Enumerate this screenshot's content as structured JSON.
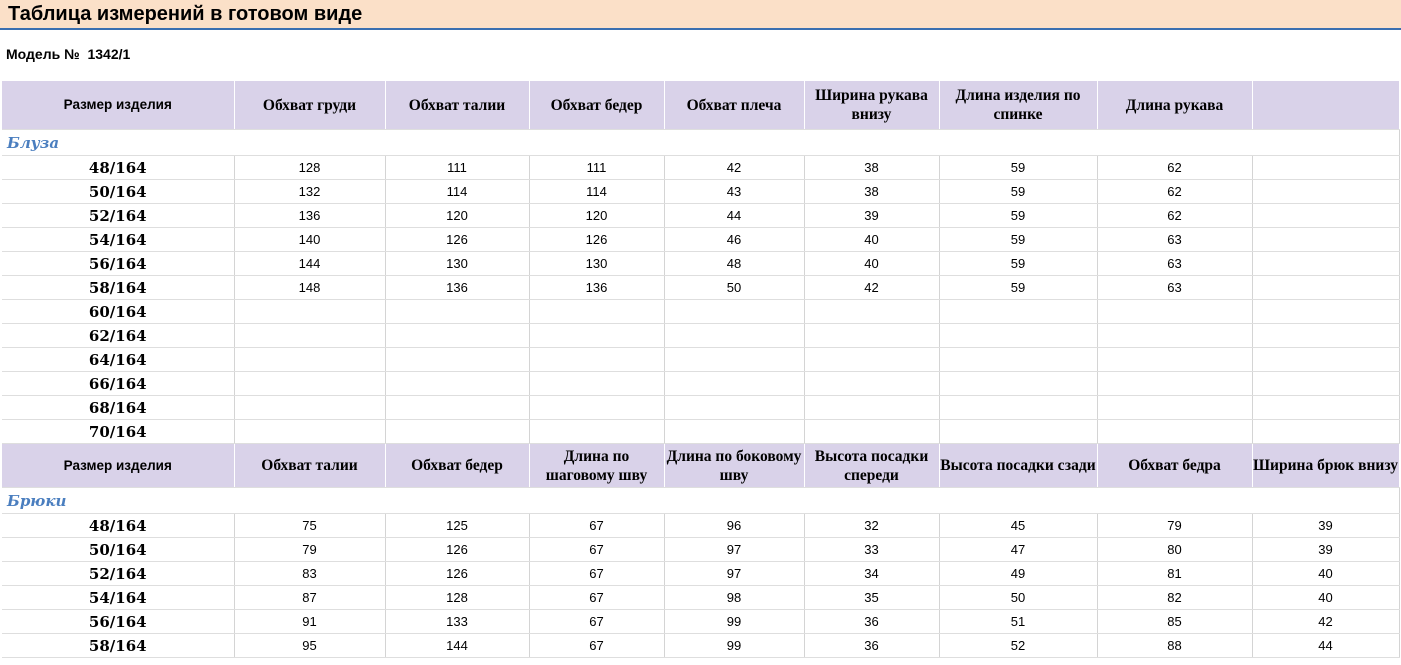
{
  "title": "Таблица измерений в готовом виде",
  "model": "Модель №  1342/1",
  "blouse": {
    "section_name": "Блуза",
    "headers": [
      "Размер изделия",
      "Обхват груди",
      "Обхват талии",
      "Обхват бедер",
      "Обхват плеча",
      "Ширина рукава внизу",
      "Длина изделия по спинке",
      "Длина рукава",
      ""
    ],
    "rows": [
      [
        "48/164",
        "128",
        "111",
        "111",
        "42",
        "38",
        "59",
        "62",
        ""
      ],
      [
        "50/164",
        "132",
        "114",
        "114",
        "43",
        "38",
        "59",
        "62",
        ""
      ],
      [
        "52/164",
        "136",
        "120",
        "120",
        "44",
        "39",
        "59",
        "62",
        ""
      ],
      [
        "54/164",
        "140",
        "126",
        "126",
        "46",
        "40",
        "59",
        "63",
        ""
      ],
      [
        "56/164",
        "144",
        "130",
        "130",
        "48",
        "40",
        "59",
        "63",
        ""
      ],
      [
        "58/164",
        "148",
        "136",
        "136",
        "50",
        "42",
        "59",
        "63",
        ""
      ],
      [
        "60/164",
        "",
        "",
        "",
        "",
        "",
        "",
        "",
        ""
      ],
      [
        "62/164",
        "",
        "",
        "",
        "",
        "",
        "",
        "",
        ""
      ],
      [
        "64/164",
        "",
        "",
        "",
        "",
        "",
        "",
        "",
        ""
      ],
      [
        "66/164",
        "",
        "",
        "",
        "",
        "",
        "",
        "",
        ""
      ],
      [
        "68/164",
        "",
        "",
        "",
        "",
        "",
        "",
        "",
        ""
      ],
      [
        "70/164",
        "",
        "",
        "",
        "",
        "",
        "",
        "",
        ""
      ]
    ]
  },
  "trousers": {
    "section_name": "Брюки",
    "headers": [
      "Размер изделия",
      "Обхват талии",
      "Обхват бедер",
      "Длина по шаговому шву",
      "Длина по боковому шву",
      "Высота посадки спереди",
      "Высота посадки сзади",
      "Обхват бедра",
      "Ширина брюк внизу"
    ],
    "rows": [
      [
        "48/164",
        "75",
        "125",
        "67",
        "96",
        "32",
        "45",
        "79",
        "39"
      ],
      [
        "50/164",
        "79",
        "126",
        "67",
        "97",
        "33",
        "47",
        "80",
        "39"
      ],
      [
        "52/164",
        "83",
        "126",
        "67",
        "97",
        "34",
        "49",
        "81",
        "40"
      ],
      [
        "54/164",
        "87",
        "128",
        "67",
        "98",
        "35",
        "50",
        "82",
        "40"
      ],
      [
        "56/164",
        "91",
        "133",
        "67",
        "99",
        "36",
        "51",
        "85",
        "42"
      ],
      [
        "58/164",
        "95",
        "144",
        "67",
        "99",
        "36",
        "52",
        "88",
        "44"
      ]
    ]
  }
}
